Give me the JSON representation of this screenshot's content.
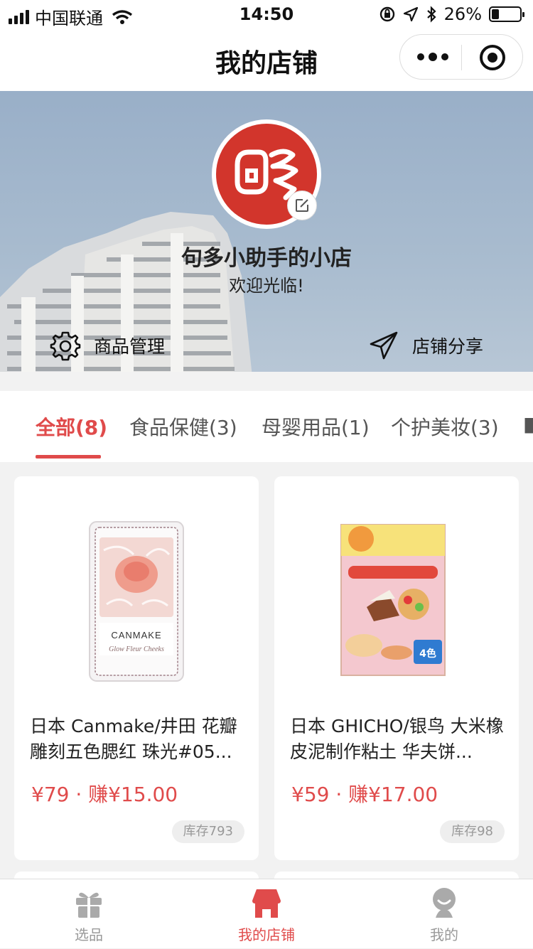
{
  "status_bar": {
    "carrier": "中国联通",
    "time": "14:50",
    "battery": "26%",
    "battery_level": 0.26
  },
  "nav": {
    "title": "我的店铺"
  },
  "shop": {
    "name": "句多小助手的小店",
    "welcome": "欢迎光临!"
  },
  "actions": {
    "manage": "商品管理",
    "share": "店铺分享"
  },
  "tabs": [
    "全部(8)",
    "食品保健(3)",
    "母婴用品(1)",
    "个护美妆(3)"
  ],
  "products": [
    {
      "name": "日本 Canmake/井田 花瓣雕刻五色腮红 珠光#05...",
      "price": "¥79 · 赚¥15.00",
      "stock": "库存793",
      "image_label_1": "CANMAKE",
      "image_label_2": "Glow Fleur Cheeks"
    },
    {
      "name": "日本 GHICHO/银鸟 大米橡皮泥制作粘土 华夫饼...",
      "price": "¥59 · 赚¥17.00",
      "stock": "库存98",
      "image_label_1": "4色"
    }
  ],
  "tabbar": [
    "选品",
    "我的店铺",
    "我的"
  ],
  "colors": {
    "accent": "#e04b4b",
    "brand_red": "#d2352c"
  }
}
